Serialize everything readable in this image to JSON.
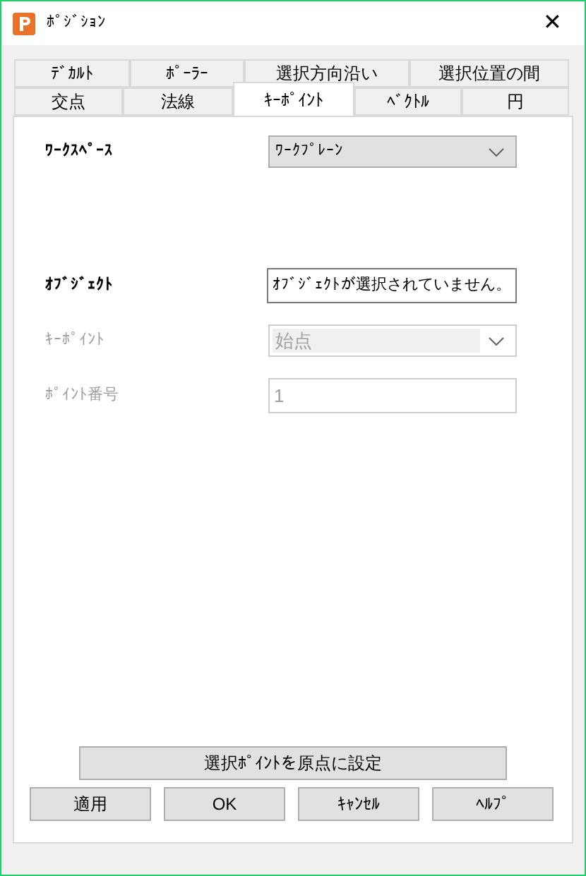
{
  "window": {
    "title": "ﾎﾟｼﾞｼｮﾝ",
    "close": "✕"
  },
  "tab_rows": [
    [
      {
        "label": "ﾃﾞｶﾙﾄ",
        "selected": false
      },
      {
        "label": "ﾎﾟｰﾗｰ",
        "selected": false
      },
      {
        "label": "選択方向沿い",
        "selected": false
      },
      {
        "label": "選択位置の間",
        "selected": false
      }
    ],
    [
      {
        "label": "交点",
        "selected": false
      },
      {
        "label": "法線",
        "selected": false
      },
      {
        "label": "ｷｰﾎﾟｲﾝﾄ",
        "selected": true
      },
      {
        "label": "ﾍﾞｸﾄﾙ",
        "selected": false
      },
      {
        "label": "円",
        "selected": false
      }
    ]
  ],
  "fields": [
    {
      "kind": "combo",
      "label": "ﾜｰｸｽﾍﾟｰｽ",
      "value": "ﾜｰｸﾌﾟﾚｰﾝ",
      "disabled": false
    },
    {
      "kind": "gap"
    },
    {
      "kind": "text",
      "label": "ｵﾌﾞｼﾞｪｸﾄ",
      "value": "ｵﾌﾞｼﾞｪｸﾄが選択されていません。",
      "disabled": false
    },
    {
      "kind": "combo",
      "label": "ｷｰﾎﾟｲﾝﾄ",
      "value": "始点",
      "disabled": true
    },
    {
      "kind": "text",
      "label": "ﾎﾟｲﾝﾄ番号",
      "value": "1",
      "disabled": true
    }
  ],
  "set_origin_button": "選択ﾎﾟｲﾝﾄを原点に設定",
  "buttons": [
    "適用",
    "OK",
    "ｷｬﾝｾﾙ",
    "ﾍﾙﾌﾟ"
  ]
}
